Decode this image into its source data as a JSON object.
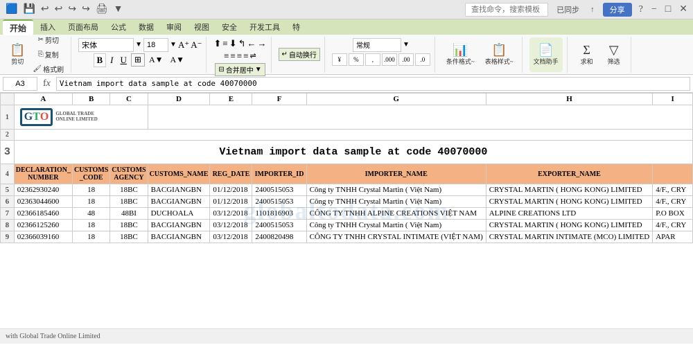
{
  "topbar": {
    "search_placeholder": "查找命令，搜索模板",
    "sync_label": "已同步",
    "share_label": "分享",
    "help_icon": "?",
    "minimize_icon": "−",
    "maximize_icon": "□",
    "close_icon": "✕"
  },
  "ribbon": {
    "tabs": [
      "开始",
      "插入",
      "页面布局",
      "公式",
      "数据",
      "审阅",
      "视图",
      "安全",
      "开发工具",
      "特"
    ],
    "active_tab": "开始"
  },
  "toolbar": {
    "cut_label": "剪切",
    "copy_label": "复制",
    "paste_label": "格式刷",
    "font_name": "宋体",
    "font_size": "18",
    "bold": "B",
    "italic": "I",
    "underline": "U",
    "merge_label": "合并居中",
    "wrap_label": "自动换行",
    "num_format": "常规",
    "percent": "%",
    "comma": ",",
    "increase_decimal": ".00",
    "decrease_decimal": ".0",
    "cond_format": "条件格式~",
    "table_format": "表格样式~",
    "doc_assist": "文档助手",
    "sum_label": "求和",
    "filter_label": "筛选"
  },
  "formula_bar": {
    "cell_ref": "A3",
    "formula_text": "Vietnam import data sample at code 40070000"
  },
  "sheet": {
    "title": "Vietnam import data sample at code 40070000",
    "col_headers": [
      "A",
      "B",
      "C",
      "D",
      "E",
      "F",
      "G",
      "H",
      "I"
    ],
    "row_numbers": [
      "1",
      "2",
      "3",
      "4",
      "5",
      "6",
      "7",
      "8"
    ],
    "table_headers": [
      "DECLARATION_\nNUMBER",
      "CUSTOMS\n_CODE",
      "CUSTOMS\nAGENCY",
      "CUSTOMS_NAME",
      "REG_DATE",
      "IMPORTER_ID",
      "IMPORTER_NAME",
      "EXPORTER_NAME",
      ""
    ],
    "rows": [
      {
        "decl_number": "02362930240",
        "customs_code": "18",
        "customs_agency": "18BC",
        "customs_name": "BACGIANGBN",
        "reg_date": "01/12/2018",
        "importer_id": "2400515053",
        "importer_name": "Công ty TNHH Crystal Martin ( Việt Nam)",
        "exporter_name": "CRYSTAL MARTIN ( HONG KONG) LIMITED",
        "extra": "4/F., CRY"
      },
      {
        "decl_number": "02363044600",
        "customs_code": "18",
        "customs_agency": "18BC",
        "customs_name": "BACGIANGBN",
        "reg_date": "01/12/2018",
        "importer_id": "2400515053",
        "importer_name": "Công ty TNHH Crystal Martin ( Việt Nam)",
        "exporter_name": "CRYSTAL MARTIN ( HONG KONG) LIMITED",
        "extra": "4/F., CRY"
      },
      {
        "decl_number": "02366185460",
        "customs_code": "48",
        "customs_agency": "48BI",
        "customs_name": "DUCHOALA",
        "reg_date": "03/12/2018",
        "importer_id": "1101816903",
        "importer_name": "CÔNG TY TNHH ALPINE CREATIONS VIỆT NAM",
        "exporter_name": "ALPINE CREATIONS  LTD",
        "extra": "P.O BOX"
      },
      {
        "decl_number": "02366125260",
        "customs_code": "18",
        "customs_agency": "18BC",
        "customs_name": "BACGIANGBN",
        "reg_date": "03/12/2018",
        "importer_id": "2400515053",
        "importer_name": "Công ty TNHH Crystal Martin ( Việt Nam)",
        "exporter_name": "CRYSTAL MARTIN ( HONG KONG) LIMITED",
        "extra": "4/F., CRY"
      },
      {
        "decl_number": "02366039160",
        "customs_code": "18",
        "customs_agency": "18BC",
        "customs_name": "BACGIANGBN",
        "reg_date": "03/12/2018",
        "importer_id": "2400820498",
        "importer_name": "CÔNG TY TNHH CRYSTAL INTIMATE (VIỆT NAM)",
        "exporter_name": "CRYSTAL MARTIN INTIMATE (MCO) LIMITED",
        "extra": "APAR"
      }
    ],
    "watermark": "globaltodata.com"
  },
  "bottombar": {
    "label": "with Global Trade Online Limited"
  },
  "logo": {
    "brand": "GTO",
    "tagline": "GLOBAL TRADE ONLINE LIMITED"
  }
}
